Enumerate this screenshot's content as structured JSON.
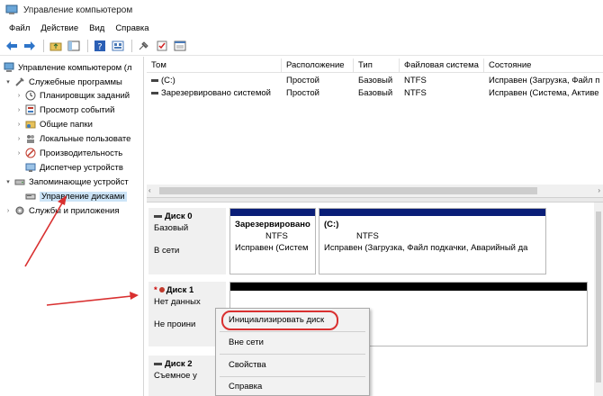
{
  "window": {
    "title": "Управление компьютером"
  },
  "menu": [
    "Файл",
    "Действие",
    "Вид",
    "Справка"
  ],
  "tree": {
    "root": "Управление компьютером (л",
    "utilities": "Служебные программы",
    "scheduler": "Планировщик заданий",
    "events": "Просмотр событий",
    "shared": "Общие папки",
    "users": "Локальные пользовате",
    "perf": "Производительность",
    "devmgr": "Диспетчер устройств",
    "storage": "Запоминающие устройст",
    "diskmgmt": "Управление дисками",
    "services": "Службы и приложения"
  },
  "volumes": {
    "headers": [
      "Том",
      "Расположение",
      "Тип",
      "Файловая система",
      "Состояние"
    ],
    "rows": [
      [
        "(C:)",
        "Простой",
        "Базовый",
        "NTFS",
        "Исправен (Загрузка, Файл п"
      ],
      [
        "Зарезервировано системой",
        "Простой",
        "Базовый",
        "NTFS",
        "Исправен (Система, Активе"
      ]
    ]
  },
  "disk0": {
    "name": "Диск 0",
    "type": "Базовый",
    "status": "В сети",
    "p1": {
      "name": "Зарезервировано",
      "fs": "NTFS",
      "status": "Исправен (Систем"
    },
    "p2": {
      "name": "(C:)",
      "fs": "NTFS",
      "status": "Исправен (Загрузка, Файл подкачки, Аварийный да"
    }
  },
  "disk1": {
    "prefix": "*",
    "name": "Диск 1",
    "line1": "Нет данных",
    "line2": "Не проини"
  },
  "disk2": {
    "name": "Диск 2",
    "line1": "Съемное у"
  },
  "context_menu": {
    "init": "Инициализировать диск",
    "offline": "Вне сети",
    "props": "Свойства",
    "help": "Справка"
  },
  "colors": {
    "partition_bar": "#0a1e78",
    "unallocated_bar": "#000000",
    "annotation": "#d93030"
  }
}
